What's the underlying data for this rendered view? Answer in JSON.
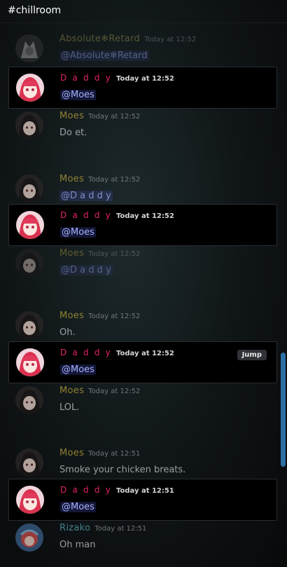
{
  "channel": "#chillroom",
  "jump_label": "Jump",
  "messages": [
    {
      "author": "Absolute❄Retard",
      "time": "Today at 12:52",
      "text": "@Absolute❄Retard",
      "mention": true,
      "highlight": false
    },
    {
      "author": "D a d d y",
      "time": "Today at 12:52",
      "text": "@Moes",
      "mention": true,
      "highlight": true
    },
    {
      "author": "Moes",
      "time": "Today at 12:52",
      "text": "Do et.",
      "mention": false,
      "highlight": false
    },
    {
      "author": "Moes",
      "time": "Today at 12:52",
      "text": "@D a d d y",
      "mention": true,
      "highlight": false
    },
    {
      "author": "D a d d y",
      "time": "Today at 12:52",
      "text": "@Moes",
      "mention": true,
      "highlight": true
    },
    {
      "author": "Moes",
      "time": "Today at 12:52",
      "text": "@D a d d y",
      "mention": true,
      "highlight": false
    },
    {
      "author": "Moes",
      "time": "Today at 12:52",
      "text": "Oh.",
      "mention": false,
      "highlight": false
    },
    {
      "author": "D a d d y",
      "time": "Today at 12:52",
      "text": "@Moes",
      "mention": true,
      "highlight": true
    },
    {
      "author": "Moes",
      "time": "Today at 12:52",
      "text": "LOL.",
      "mention": false,
      "highlight": false
    },
    {
      "author": "Moes",
      "time": "Today at 12:51",
      "text": "Smoke your chicken breats.",
      "mention": false,
      "highlight": false
    },
    {
      "author": "D a d d y",
      "time": "Today at 12:51",
      "text": "@Moes",
      "mention": true,
      "highlight": true
    },
    {
      "author": "Rizako",
      "time": "Today at 12:51",
      "text": "Oh man",
      "mention": false,
      "highlight": false
    }
  ],
  "colors": {
    "daddy": "#e0245e",
    "moes": "#b8a33a",
    "rizako": "#5aa5b8",
    "absolute": "#a8a050",
    "mention_bg": "#5865f2",
    "scrollbar": "#2b6fa3"
  },
  "icons": {
    "avatar_daddy": "anime-girl-pink-avatar",
    "avatar_moes": "anime-girl-dark-avatar",
    "avatar_absolute": "wolf-avatar",
    "avatar_rizako": "character-avatar"
  }
}
